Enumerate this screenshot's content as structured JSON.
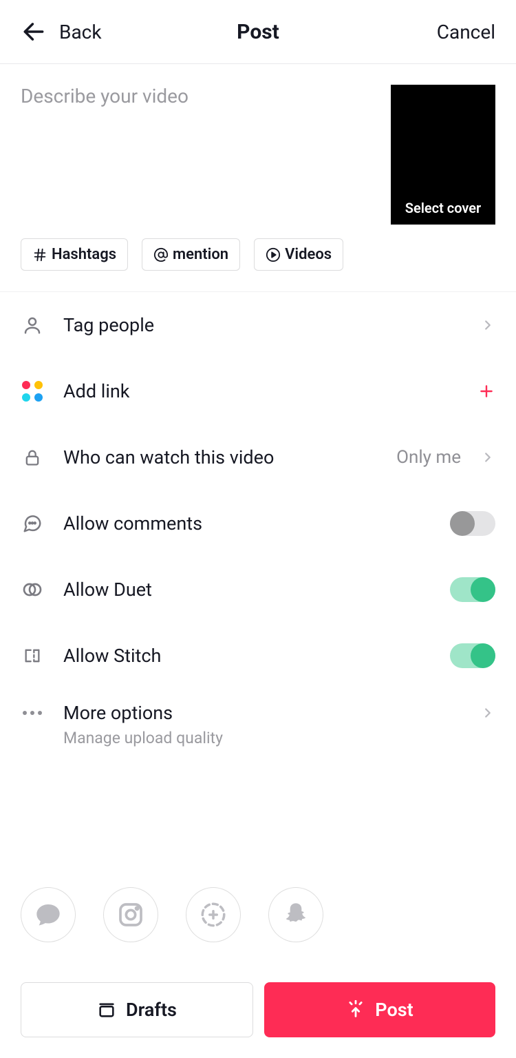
{
  "header": {
    "back_label": "Back",
    "title": "Post",
    "cancel_label": "Cancel"
  },
  "description": {
    "placeholder": "Describe your video",
    "value": "",
    "cover_label": "Select cover"
  },
  "chips": {
    "hashtags": "Hashtags",
    "mention": "mention",
    "videos": "Videos"
  },
  "rows": {
    "tag_people": "Tag people",
    "add_link": "Add link",
    "privacy_label": "Who can watch this video",
    "privacy_value": "Only me",
    "allow_comments": "Allow comments",
    "allow_duet": "Allow Duet",
    "allow_stitch": "Allow Stitch",
    "more_options": "More options",
    "more_options_sub": "Manage upload quality"
  },
  "toggles": {
    "allow_comments": false,
    "allow_duet": true,
    "allow_stitch": true
  },
  "share_targets": [
    "message",
    "instagram",
    "story",
    "snapchat"
  ],
  "footer": {
    "drafts": "Drafts",
    "post": "Post"
  },
  "colors": {
    "primary": "#fe2c55",
    "toggle_on": "#34c388"
  }
}
